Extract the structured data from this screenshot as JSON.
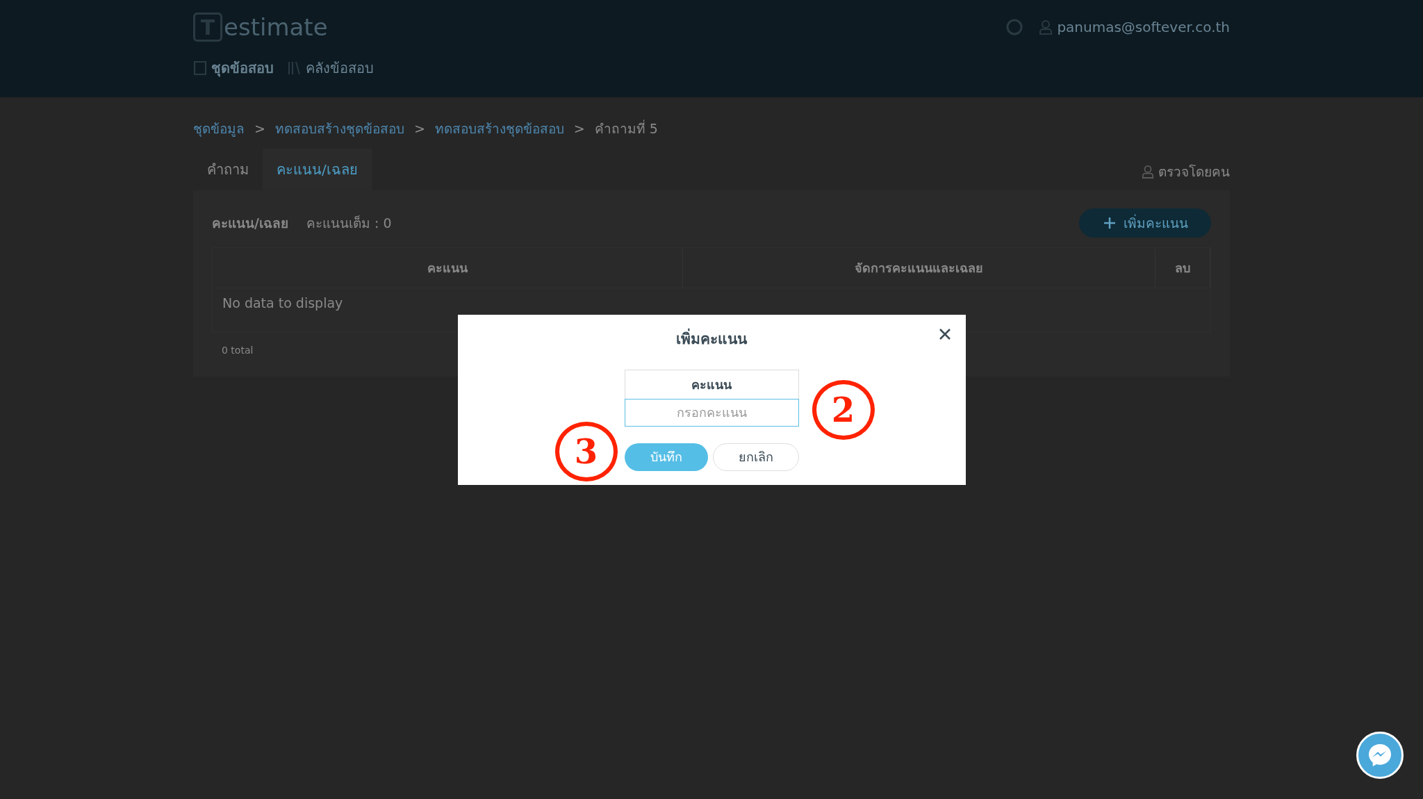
{
  "header": {
    "logo": {
      "letter": "T",
      "text": "estimate"
    },
    "user_email": "panumas@softever.co.th",
    "nav": [
      {
        "label": "ชุดข้อสอบ",
        "selected": true
      },
      {
        "label": "คลังข้อสอบ",
        "selected": false
      }
    ]
  },
  "breadcrumb": {
    "separator": ">",
    "items": [
      "ชุดข้อมูล",
      "ทดสอบสร้างชุดข้อสอบ",
      "ทดสอบสร้างชุดข้อสอบ",
      "คำถามที่ 5"
    ]
  },
  "tabs": [
    {
      "label": "คำถาม",
      "selected": false
    },
    {
      "label": "คะแนน/เฉลย",
      "selected": true
    }
  ],
  "reviewer": "ตรวจโดยคน",
  "card": {
    "title": "คะแนน/เฉลย",
    "full_score": "คะแนนเต็ม : 0",
    "add_button": "เพิ่มคะแนน",
    "table": {
      "columns": [
        "คะแนน",
        "จัดการคะแนนและเฉลย",
        "ลบ"
      ],
      "empty": "No data to display",
      "footer": "0 total"
    }
  },
  "modal": {
    "title": "เพิ่มคะแนน",
    "field_label": "คะแนน",
    "placeholder": "กรอกคะแนน",
    "save_button": "บันทึก",
    "cancel_button": "ยกเลิก"
  },
  "annotations": [
    "2",
    "3"
  ]
}
